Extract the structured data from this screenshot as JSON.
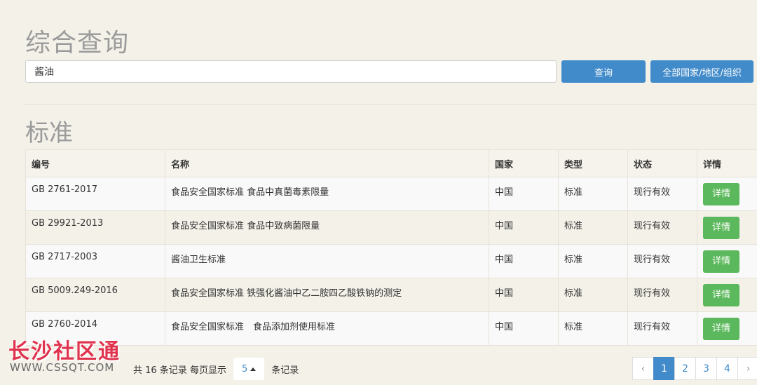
{
  "search": {
    "title": "综合查询",
    "value": "酱油",
    "query_label": "查询",
    "all_label": "全部国家/地区/组织"
  },
  "standards": {
    "title": "标准",
    "headers": [
      "编号",
      "名称",
      "国家",
      "类型",
      "状态",
      "详情"
    ],
    "rows": [
      {
        "code": "GB 2761-2017",
        "name": "食品安全国家标准 食品中真菌毒素限量",
        "country": "中国",
        "type": "标准",
        "status": "现行有效",
        "detail": "详情"
      },
      {
        "code": "GB 29921-2013",
        "name": "食品安全国家标准 食品中致病菌限量",
        "country": "中国",
        "type": "标准",
        "status": "现行有效",
        "detail": "详情"
      },
      {
        "code": "GB 2717-2003",
        "name": "酱油卫生标准",
        "country": "中国",
        "type": "标准",
        "status": "现行有效",
        "detail": "详情"
      },
      {
        "code": "GB 5009.249-2016",
        "name": "食品安全国家标准 铁强化酱油中乙二胺四乙酸铁钠的测定",
        "country": "中国",
        "type": "标准",
        "status": "现行有效",
        "detail": "详情"
      },
      {
        "code": "GB 2760-2014",
        "name": "食品安全国家标准　食品添加剂使用标准",
        "country": "中国",
        "type": "标准",
        "status": "现行有效",
        "detail": "详情"
      }
    ]
  },
  "pager": {
    "summary": "共 16 条记录 每页显示",
    "page_size": "5",
    "suffix": "条记录",
    "prev": "‹",
    "pages": [
      "1",
      "2",
      "3",
      "4"
    ],
    "next": "›"
  },
  "watermark": {
    "text": "长沙社区通",
    "url": "WWW.CSSQT.COM"
  }
}
